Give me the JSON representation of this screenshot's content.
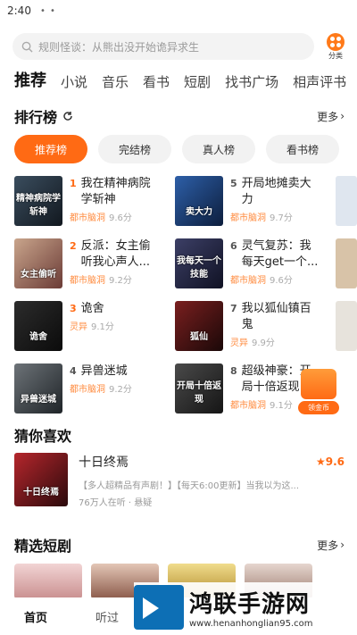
{
  "status": {
    "time": "2:40",
    "dots": "• •"
  },
  "search": {
    "placeholder": "规则怪谈：从熊出没开始诡异求生"
  },
  "category": {
    "label": "分类"
  },
  "tabs": [
    "推荐",
    "小说",
    "音乐",
    "看书",
    "短剧",
    "找书广场",
    "相声评书"
  ],
  "ranking": {
    "title": "排行榜",
    "more": "更多",
    "pills": [
      "推荐榜",
      "完结榜",
      "真人榜",
      "看书榜"
    ],
    "items": [
      {
        "num": "1",
        "title": "我在精神病院学斩神",
        "tag": "都市脑洞",
        "score": "9.6分",
        "cover_text": "精神病院学斩神"
      },
      {
        "num": "2",
        "title": "反派：女主偷听我心声人...",
        "tag": "都市脑洞",
        "score": "9.2分",
        "cover_text": "女主偷听"
      },
      {
        "num": "3",
        "title": "诡舍",
        "tag": "灵异",
        "score": "9.1分",
        "cover_text": "诡舍"
      },
      {
        "num": "4",
        "title": "异兽迷城",
        "tag": "都市脑洞",
        "score": "9.2分",
        "cover_text": "异兽迷城"
      },
      {
        "num": "5",
        "title": "开局地摊卖大力",
        "tag": "都市脑洞",
        "score": "9.7分",
        "cover_text": "卖大力"
      },
      {
        "num": "6",
        "title": "灵气复苏：我每天get一个...",
        "tag": "都市脑洞",
        "score": "9.6分",
        "cover_text": "我每天一个技能"
      },
      {
        "num": "7",
        "title": "我以狐仙镇百鬼",
        "tag": "灵异",
        "score": "9.9分",
        "cover_text": "狐仙"
      },
      {
        "num": "8",
        "title": "超级神豪：开局十倍返现",
        "tag": "都市脑洞",
        "score": "9.1分",
        "cover_text": "开局十倍返现"
      }
    ]
  },
  "gold": {
    "label": "领金币"
  },
  "guess": {
    "title": "猜你喜欢",
    "book": {
      "title": "十日终焉",
      "score": "9.6",
      "desc": "【多人超精品有声剧！】【每天6:00更新】当我以为这...",
      "meta": "76万人在听 · 悬疑",
      "cover_text": "十日终焉"
    }
  },
  "shorts": {
    "title": "精选短剧",
    "more": "更多"
  },
  "nav": [
    "首页",
    "听过"
  ],
  "watermark": {
    "title": "鸿联手游网",
    "url": "www.henanhonglian95.com"
  },
  "colors": {
    "accent": "#ff6a14",
    "tag": "#ff8a3d"
  }
}
